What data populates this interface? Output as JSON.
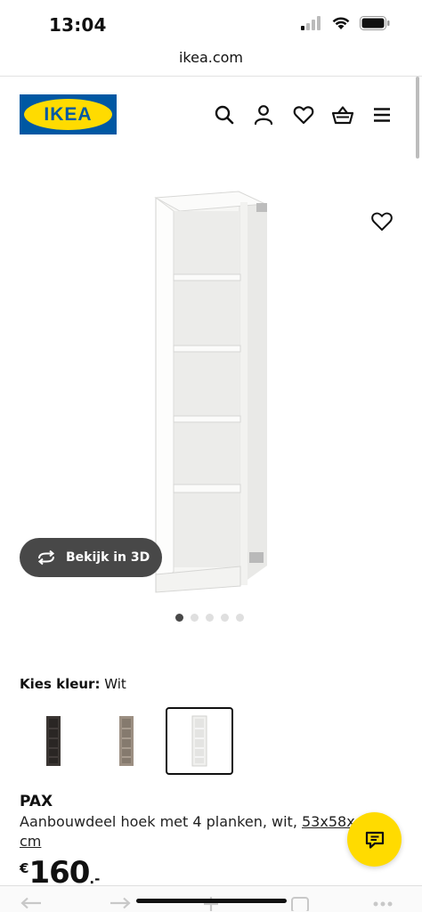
{
  "status_bar": {
    "time": "13:04",
    "icons": [
      "signal-icon",
      "wifi-icon",
      "battery-icon"
    ]
  },
  "browser": {
    "url": "ikea.com"
  },
  "header": {
    "logo_text": "IKEA",
    "icons": [
      "search-icon",
      "account-icon",
      "heart-icon",
      "basket-icon",
      "menu-icon"
    ],
    "brand_colors": {
      "blue": "#0058a3",
      "yellow": "#ffdb00"
    }
  },
  "product_image": {
    "view_3d_label": "Bekijk in 3D",
    "carousel_total": 5,
    "carousel_active": 1
  },
  "color_picker": {
    "label": "Kies kleur:",
    "selected_value": "Wit",
    "swatches": [
      {
        "name": "black-brown",
        "color": "#3b3633",
        "selected": false
      },
      {
        "name": "grey-beige",
        "color": "#9c8f82",
        "selected": false
      },
      {
        "name": "white",
        "color": "#f0f0ee",
        "selected": true
      }
    ]
  },
  "product": {
    "name": "PAX",
    "description": "Aanbouwdeel hoek met 4 planken, wit,",
    "dimensions_link": "53x58x",
    "dimensions_unit": "cm",
    "price_currency": "€",
    "price_main": "160",
    "price_decimal": ".-"
  },
  "chat": {
    "icon": "chat-icon"
  }
}
